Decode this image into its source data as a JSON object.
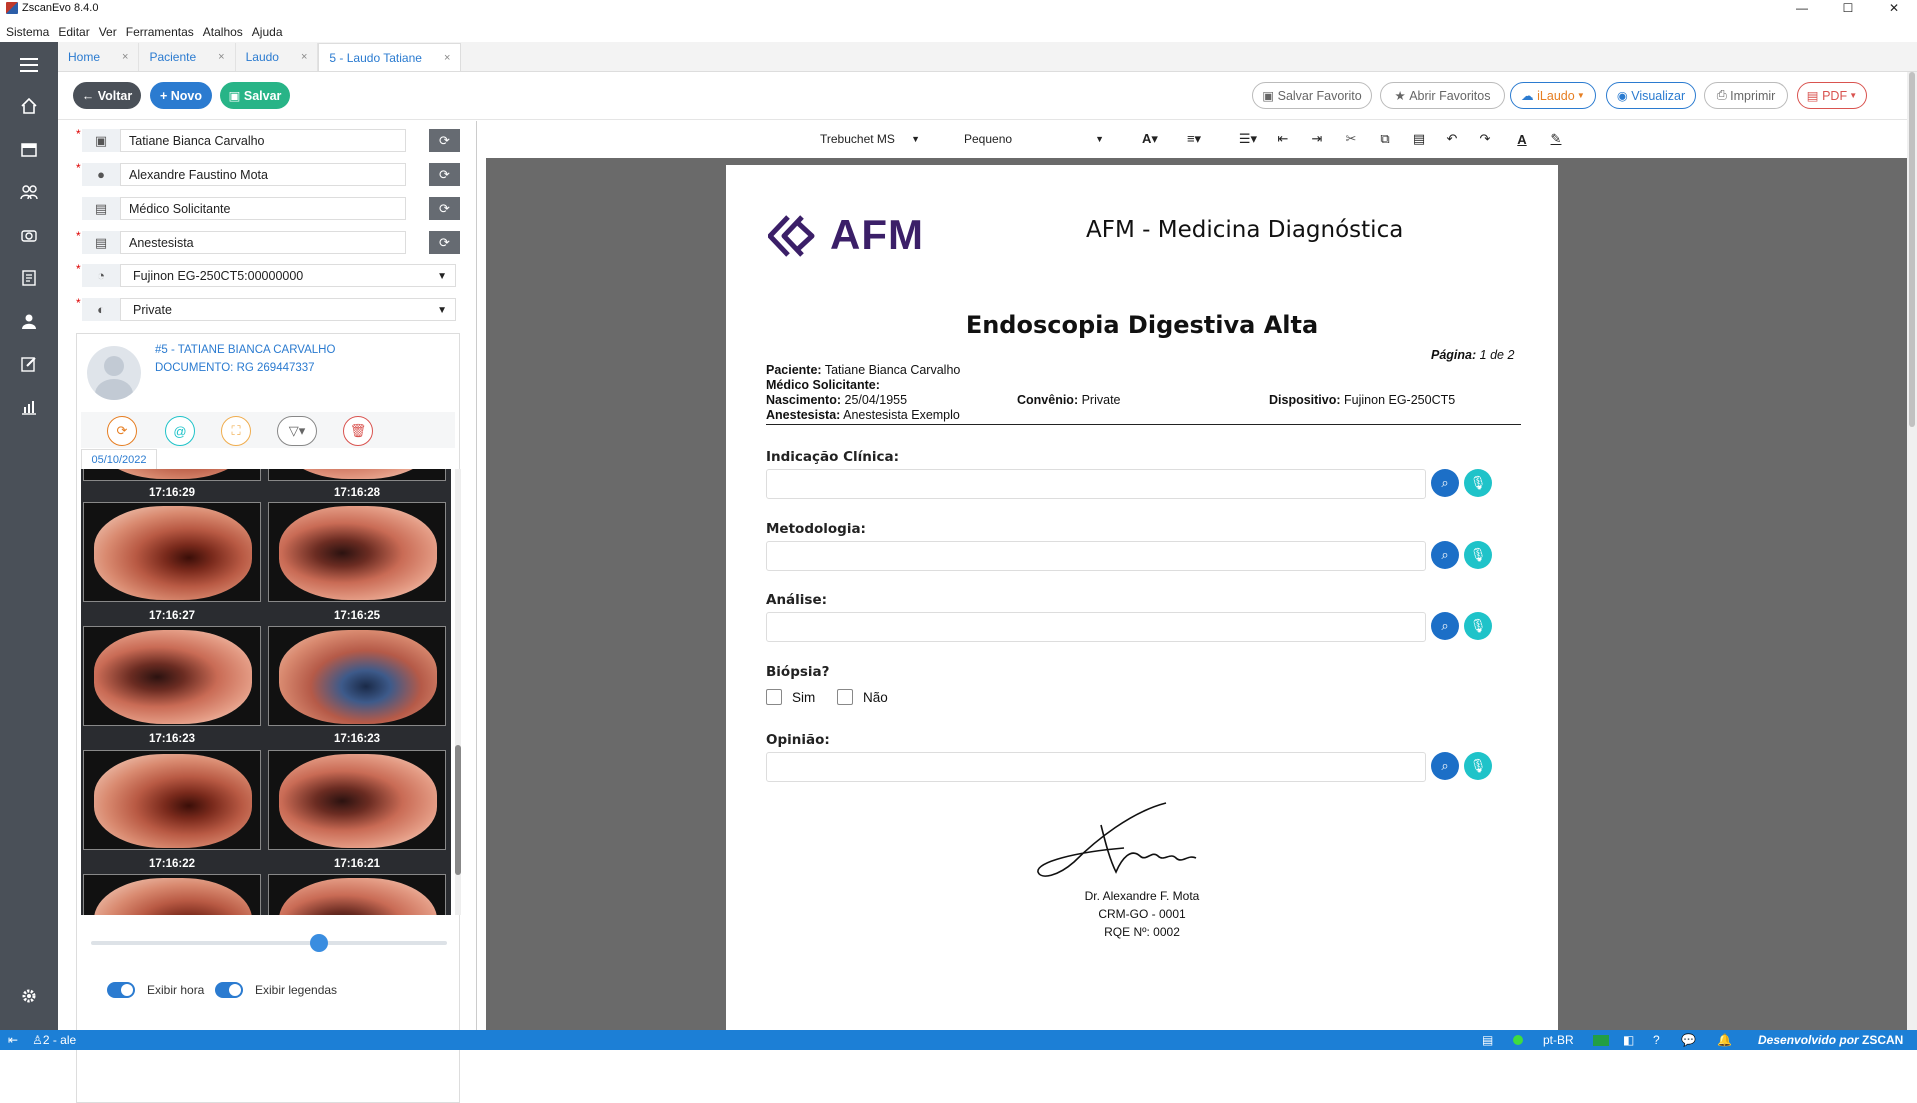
{
  "window": {
    "title": "ZscanEvo 8.4.0",
    "minimize": "—",
    "maximize": "☐",
    "close": "✕"
  },
  "menu": [
    "Sistema",
    "Editar",
    "Ver",
    "Ferramentas",
    "Atalhos",
    "Ajuda"
  ],
  "tabs": [
    {
      "label": "Home",
      "close": "×"
    },
    {
      "label": "Paciente",
      "close": "×"
    },
    {
      "label": "Laudo",
      "close": "×"
    },
    {
      "label": "5 - Laudo Tatiane",
      "close": "×"
    }
  ],
  "toolbar": {
    "voltar": "← Voltar",
    "novo": "+ Novo",
    "salvar": "Salvar",
    "salvar_favorito": "Salvar Favorito",
    "abrir_favoritos": "Abrir Favoritos",
    "ilaudo": "iLaudo",
    "visualizar": "Visualizar",
    "imprimir": "Imprimir",
    "pdf": "PDF"
  },
  "form": {
    "paciente": "Tatiane Bianca Carvalho",
    "medico": "Alexandre Faustino Mota",
    "solicitante": "Médico Solicitante",
    "anestesista": "Anestesista",
    "dispositivo": "Fujinon EG-250CT5:00000000",
    "convenio": "Private"
  },
  "patient_card": {
    "name": "#5 - TATIANE BIANCA CARVALHO",
    "document": "DOCUMENTO: RG 269447337",
    "date_tab": "05/10/2022"
  },
  "gallery": {
    "times": [
      "17:16:29",
      "17:16:28",
      "17:16:27",
      "17:16:25",
      "17:16:23",
      "17:16:23",
      "17:16:22",
      "17:16:21"
    ]
  },
  "gallery_controls": {
    "zoom_level": 0.64,
    "exibir_hora": "Exibir hora",
    "exibir_legendas": "Exibir legendas"
  },
  "editor": {
    "font": "Trebuchet MS",
    "size": "Pequeno"
  },
  "report": {
    "logo_text": "AFM",
    "clinic": "AFM - Medicina Diagnóstica",
    "title": "Endoscopia Digestiva Alta",
    "page_label": "Página:",
    "page_value": "1 de 2",
    "paciente_label": "Paciente:",
    "paciente_value": "Tatiane Bianca Carvalho",
    "solicitante_label": "Médico Solicitante:",
    "nascimento_label": "Nascimento:",
    "nascimento_value": "25/04/1955",
    "convenio_label": "Convênio:",
    "convenio_value": "Private",
    "dispositivo_label": "Dispositivo:",
    "dispositivo_value": "Fujinon EG-250CT5",
    "anestesista_label": "Anestesista:",
    "anestesista_value": "Anestesista Exemplo",
    "indicacao": "Indicação Clínica:",
    "metodologia": "Metodologia:",
    "analise": "Análise:",
    "biopsia": "Biópsia?",
    "sim": "Sim",
    "nao": "Não",
    "opiniao": "Opinião:",
    "doctor": "Dr. Alexandre F. Mota",
    "crm": "CRM-GO - 0001",
    "rqe": "RQE Nº: 0002"
  },
  "statusbar": {
    "user": "2 - ale",
    "lang": "pt-BR",
    "footer": "Desenvolvido por",
    "brand": "ZSCAN"
  },
  "colors": {
    "accent": "#2b7bd0",
    "sidebar": "#4a5058",
    "statusbar": "#1c7fd6",
    "green": "#28b487",
    "teal": "#1fc3c9",
    "brand_purple": "#3b1f68"
  }
}
